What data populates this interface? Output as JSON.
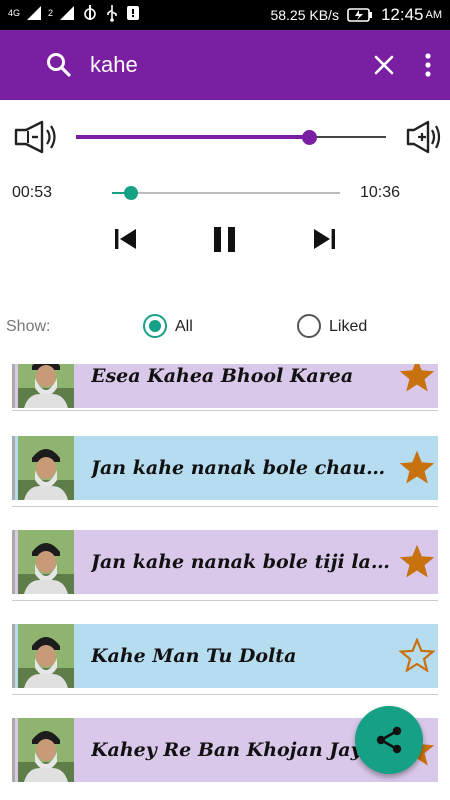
{
  "status_bar": {
    "network_4g": "4G",
    "speed": "58.25 KB/s",
    "time": "12:45",
    "ampm": "AM"
  },
  "search": {
    "query": "kahe"
  },
  "player": {
    "volume_level": 0.75,
    "current_time": "00:53",
    "total_time": "10:36",
    "progress": 0.085,
    "state": "playing"
  },
  "filter": {
    "label": "Show:",
    "options": [
      {
        "label": "All",
        "selected": true
      },
      {
        "label": "Liked",
        "selected": false
      }
    ]
  },
  "tracks": [
    {
      "title": "Esea Kahea Bhool Karea",
      "liked": true,
      "bg": "#d9c8ea"
    },
    {
      "title": "Jan kahe nanak bole chauthi laang Jaap",
      "liked": true,
      "bg": "#b6dcf0"
    },
    {
      "title": "Jan kahe nanak bole tiji laang Jaap",
      "liked": true,
      "bg": "#d9c8ea"
    },
    {
      "title": "Kahe Man Tu Dolta",
      "liked": false,
      "bg": "#b6dcf0"
    },
    {
      "title": "Kahey Re Ban Khojan Jayi",
      "liked": true,
      "bg": "#d9c8ea"
    }
  ],
  "colors": {
    "primary": "#7b1fa2",
    "accent": "#16a085",
    "star": "#c8720f"
  },
  "icons": {
    "share": "share-icon",
    "search": "search-icon",
    "close": "close-icon",
    "more": "more-vert-icon"
  }
}
